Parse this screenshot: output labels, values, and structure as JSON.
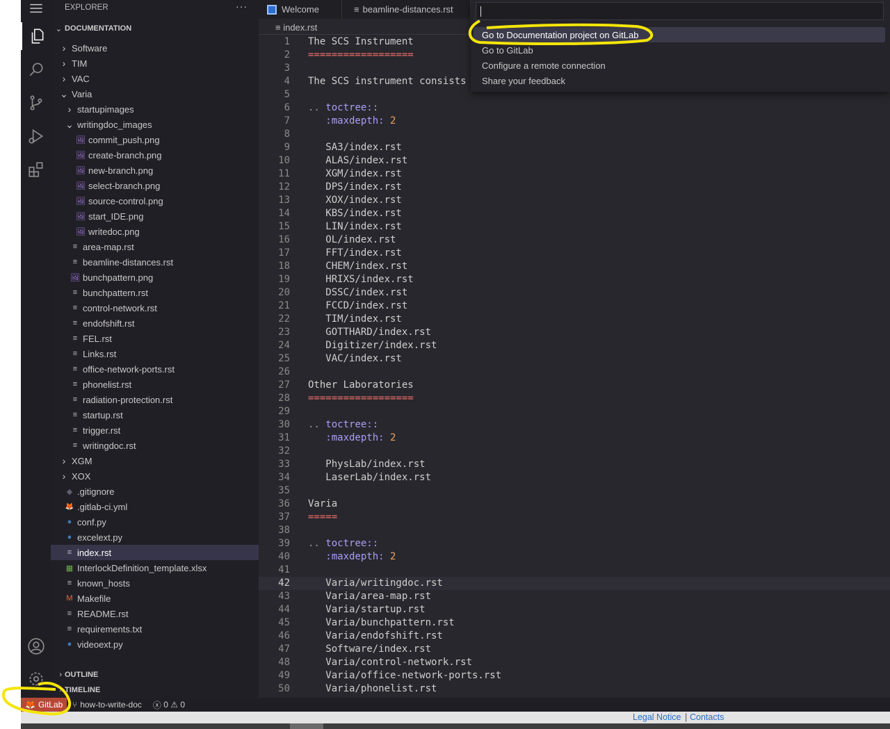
{
  "activity": {
    "icons": [
      "menu-icon",
      "files-icon",
      "search-icon",
      "source-control-icon",
      "run-debug-icon",
      "extensions-icon",
      "account-icon",
      "gear-icon"
    ]
  },
  "sidebar": {
    "title": "EXPLORER",
    "more": "···",
    "section": "DOCUMENTATION",
    "items": [
      {
        "label": "Software",
        "level": 1,
        "type": "folder",
        "open": false
      },
      {
        "label": "TIM",
        "level": 1,
        "type": "folder",
        "open": false
      },
      {
        "label": "VAC",
        "level": 1,
        "type": "folder",
        "open": false
      },
      {
        "label": "Varia",
        "level": 1,
        "type": "folder",
        "open": true
      },
      {
        "label": "startupimages",
        "level": 2,
        "type": "folder",
        "open": false
      },
      {
        "label": "writingdoc_images",
        "level": 2,
        "type": "folder",
        "open": true
      },
      {
        "label": "commit_push.png",
        "level": 3,
        "type": "image"
      },
      {
        "label": "create-branch.png",
        "level": 3,
        "type": "image"
      },
      {
        "label": "new-branch.png",
        "level": 3,
        "type": "image"
      },
      {
        "label": "select-branch.png",
        "level": 3,
        "type": "image"
      },
      {
        "label": "source-control.png",
        "level": 3,
        "type": "image"
      },
      {
        "label": "start_IDE.png",
        "level": 3,
        "type": "image"
      },
      {
        "label": "writedoc.png",
        "level": 3,
        "type": "image"
      },
      {
        "label": "area-map.rst",
        "level": 2,
        "type": "text"
      },
      {
        "label": "beamline-distances.rst",
        "level": 2,
        "type": "text"
      },
      {
        "label": "bunchpattern.png",
        "level": 2,
        "type": "image"
      },
      {
        "label": "bunchpattern.rst",
        "level": 2,
        "type": "text"
      },
      {
        "label": "control-network.rst",
        "level": 2,
        "type": "text"
      },
      {
        "label": "endofshift.rst",
        "level": 2,
        "type": "text"
      },
      {
        "label": "FEL.rst",
        "level": 2,
        "type": "text"
      },
      {
        "label": "Links.rst",
        "level": 2,
        "type": "text"
      },
      {
        "label": "office-network-ports.rst",
        "level": 2,
        "type": "text"
      },
      {
        "label": "phonelist.rst",
        "level": 2,
        "type": "text"
      },
      {
        "label": "radiation-protection.rst",
        "level": 2,
        "type": "text"
      },
      {
        "label": "startup.rst",
        "level": 2,
        "type": "text"
      },
      {
        "label": "trigger.rst",
        "level": 2,
        "type": "text"
      },
      {
        "label": "writingdoc.rst",
        "level": 2,
        "type": "text"
      },
      {
        "label": "XGM",
        "level": 1,
        "type": "folder",
        "open": false
      },
      {
        "label": "XOX",
        "level": 1,
        "type": "folder",
        "open": false
      },
      {
        "label": ".gitignore",
        "level": 1,
        "type": "git"
      },
      {
        "label": ".gitlab-ci.yml",
        "level": 1,
        "type": "gitlab"
      },
      {
        "label": "conf.py",
        "level": 1,
        "type": "python"
      },
      {
        "label": "excelext.py",
        "level": 1,
        "type": "python"
      },
      {
        "label": "index.rst",
        "level": 1,
        "type": "text",
        "selected": true
      },
      {
        "label": "InterlockDefinition_template.xlsx",
        "level": 1,
        "type": "excel"
      },
      {
        "label": "known_hosts",
        "level": 1,
        "type": "text"
      },
      {
        "label": "Makefile",
        "level": 1,
        "type": "makefile"
      },
      {
        "label": "README.rst",
        "level": 1,
        "type": "text"
      },
      {
        "label": "requirements.txt",
        "level": 1,
        "type": "text"
      },
      {
        "label": "videoext.py",
        "level": 1,
        "type": "python"
      }
    ],
    "outline": "OUTLINE",
    "timeline": "TIMELINE"
  },
  "tabs": [
    {
      "label": "Welcome",
      "icon": "welcome-icon"
    },
    {
      "label": "beamline-distances.rst",
      "icon": "file-text-icon"
    }
  ],
  "breadcrumb": "index.rst",
  "palette": {
    "input_value": "",
    "items": [
      {
        "label": "Go to Documentation project on GitLab",
        "selected": true
      },
      {
        "label": "Go to GitLab"
      },
      {
        "label": "Configure a remote connection"
      },
      {
        "label": "Share your feedback"
      }
    ]
  },
  "editor": {
    "current_line": 42,
    "lines": [
      [
        [
          "The SCS Instrument",
          "text"
        ]
      ],
      [
        [
          "==================",
          "under"
        ]
      ],
      [],
      [
        [
          "The SCS instrument consists",
          "text"
        ]
      ],
      [],
      [
        [
          ".. ",
          "punct"
        ],
        [
          "toctree::",
          "dir"
        ]
      ],
      [
        [
          "   :maxdepth: ",
          "dir"
        ],
        [
          "2",
          "num"
        ]
      ],
      [],
      [
        [
          "   SA3/index.rst",
          "text"
        ]
      ],
      [
        [
          "   ALAS/index.rst",
          "text"
        ]
      ],
      [
        [
          "   XGM/index.rst",
          "text"
        ]
      ],
      [
        [
          "   DPS/index.rst",
          "text"
        ]
      ],
      [
        [
          "   XOX/index.rst",
          "text"
        ]
      ],
      [
        [
          "   KBS/index.rst",
          "text"
        ]
      ],
      [
        [
          "   LIN/index.rst",
          "text"
        ]
      ],
      [
        [
          "   OL/index.rst",
          "text"
        ]
      ],
      [
        [
          "   FFT/index.rst",
          "text"
        ]
      ],
      [
        [
          "   CHEM/index.rst",
          "text"
        ]
      ],
      [
        [
          "   HRIXS/index.rst",
          "text"
        ]
      ],
      [
        [
          "   DSSC/index.rst",
          "text"
        ]
      ],
      [
        [
          "   FCCD/index.rst",
          "text"
        ]
      ],
      [
        [
          "   TIM/index.rst",
          "text"
        ]
      ],
      [
        [
          "   GOTTHARD/index.rst",
          "text"
        ]
      ],
      [
        [
          "   Digitizer/index.rst",
          "text"
        ]
      ],
      [
        [
          "   VAC/index.rst",
          "text"
        ]
      ],
      [],
      [
        [
          "Other Laboratories",
          "text"
        ]
      ],
      [
        [
          "==================",
          "under"
        ]
      ],
      [],
      [
        [
          ".. ",
          "punct"
        ],
        [
          "toctree::",
          "dir"
        ]
      ],
      [
        [
          "   :maxdepth: ",
          "dir"
        ],
        [
          "2",
          "num"
        ]
      ],
      [],
      [
        [
          "   PhysLab/index.rst",
          "text"
        ]
      ],
      [
        [
          "   LaserLab/index.rst",
          "text"
        ]
      ],
      [],
      [
        [
          "Varia",
          "text"
        ]
      ],
      [
        [
          "=====",
          "under"
        ]
      ],
      [],
      [
        [
          ".. ",
          "punct"
        ],
        [
          "toctree::",
          "dir"
        ]
      ],
      [
        [
          "   :maxdepth: ",
          "dir"
        ],
        [
          "2",
          "num"
        ]
      ],
      [],
      [
        [
          "   Varia/writingdoc.rst",
          "text"
        ]
      ],
      [
        [
          "   Varia/area-map.rst",
          "text"
        ]
      ],
      [
        [
          "   Varia/startup.rst",
          "text"
        ]
      ],
      [
        [
          "   Varia/bunchpattern.rst",
          "text"
        ]
      ],
      [
        [
          "   Varia/endofshift.rst",
          "text"
        ]
      ],
      [
        [
          "   Software/index.rst",
          "text"
        ]
      ],
      [
        [
          "   Varia/control-network.rst",
          "text"
        ]
      ],
      [
        [
          "   Varia/office-network-ports.rst",
          "text"
        ]
      ],
      [
        [
          "   Varia/phonelist.rst",
          "text"
        ]
      ]
    ]
  },
  "status": {
    "gitlab": "GitLab",
    "branch": "how-to-write-doc",
    "errors": "0",
    "warnings": "0"
  },
  "footer": {
    "legal": "Legal Notice",
    "contacts": "Contacts"
  },
  "colors": {
    "accent_gitlab": "#b64936",
    "annotation": "#f5e50a",
    "selection": "#37354a"
  }
}
